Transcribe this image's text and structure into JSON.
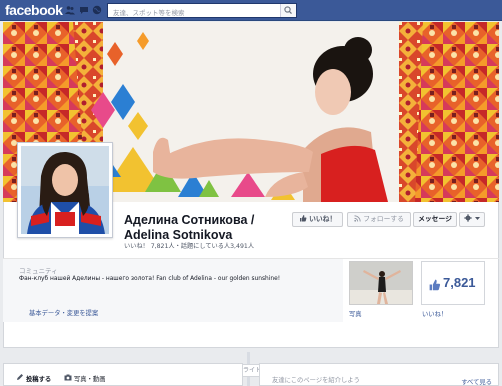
{
  "topbar": {
    "logo": "facebook",
    "search_placeholder": "友達、スポット等を検索"
  },
  "page": {
    "name_line1": "Аделина Сотникова /",
    "name_line2": "Adelina Sotnikova",
    "stats": "いいね！ 7,821人・話題にしている人3,491人",
    "buttons": {
      "like": "いいね！",
      "follow": "フォローする",
      "message": "メッセージ"
    }
  },
  "about": {
    "category": "コミュニティ",
    "description": "Фан-клуб нашей Аделины - нашего золота! Fan club of Adelina - our golden sunshine!",
    "link": "基本データ・変更を提案"
  },
  "apps": {
    "photos_label": "写真",
    "likes_count": "7,821",
    "likes_label": "いいね！"
  },
  "timeline": {
    "highlight": "ハイライト",
    "composer_status": "投稿する",
    "composer_photo": "写真・動画",
    "friends_placeholder": "友達にこのページを紹介しよう",
    "see_all": "すべて見る"
  },
  "colors": {
    "brand": "#3b5998",
    "cover_orange": "#e8622a",
    "cover_red": "#c62828",
    "cover_yellow": "#f2c230",
    "cover_blue": "#2b7fd3",
    "cover_pink": "#e84a8a"
  }
}
